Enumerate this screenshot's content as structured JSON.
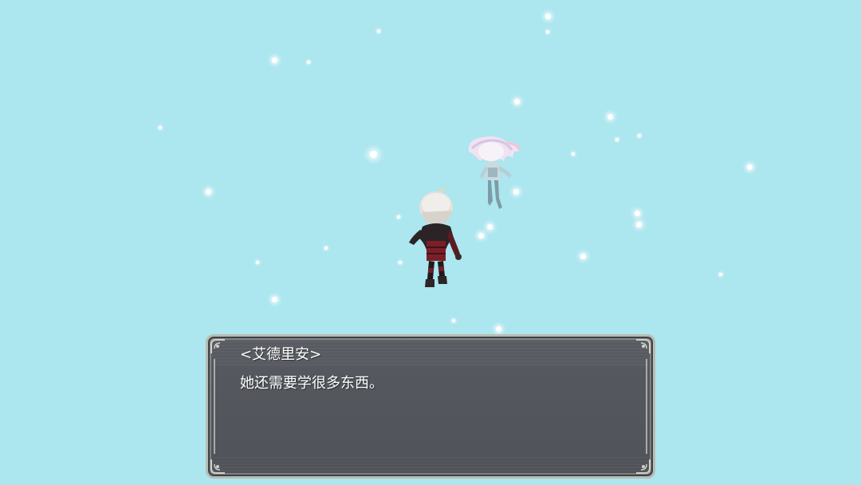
{
  "scene": {
    "background_color": "#ace6ef"
  },
  "characters": {
    "hero": {
      "icon": "silver-haired-swordsman-sprite"
    },
    "spirit": {
      "icon": "floating-white-haired-spirit-girl-sprite"
    }
  },
  "dialog": {
    "speaker": "<艾德里安>",
    "text": "她还需要学很多东西。"
  }
}
